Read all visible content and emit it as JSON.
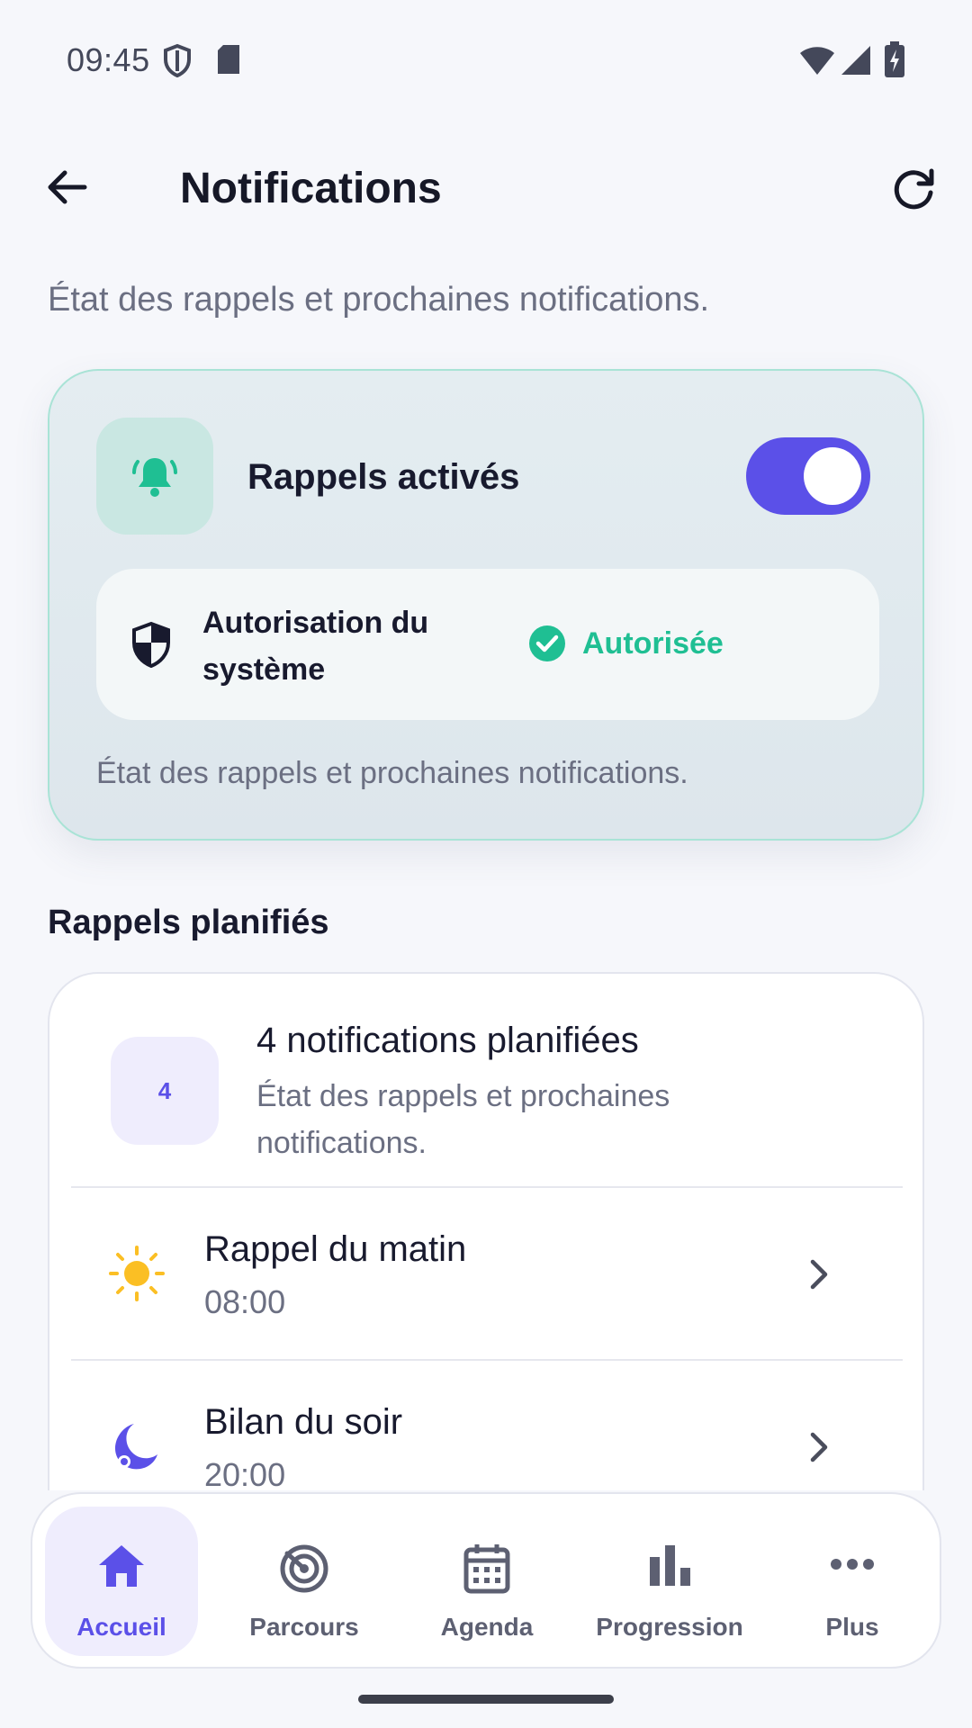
{
  "status_bar": {
    "time": "09:45"
  },
  "header": {
    "title": "Notifications"
  },
  "subtitle": "État des rappels et prochaines notifications.",
  "reminders_card": {
    "label": "Rappels activés",
    "toggle_on": true,
    "permission_label": "Autorisation du système",
    "permission_status": "Autorisée",
    "note": "État des rappels et prochaines notifications."
  },
  "scheduled": {
    "section_title": "Rappels planifiés",
    "count": "4",
    "count_title": "4 notifications planifiées",
    "count_subtitle": "État des rappels et prochaines notifications.",
    "items": [
      {
        "title": "Rappel du matin",
        "time": "08:00",
        "icon": "sun-icon"
      },
      {
        "title": "Bilan du soir",
        "time": "20:00",
        "icon": "moon-icon"
      }
    ]
  },
  "bottom_nav": [
    {
      "label": "Accueil",
      "icon": "home-icon",
      "active": true
    },
    {
      "label": "Parcours",
      "icon": "target-icon",
      "active": false
    },
    {
      "label": "Agenda",
      "icon": "calendar-icon",
      "active": false
    },
    {
      "label": "Progression",
      "icon": "bar-chart-icon",
      "active": false
    },
    {
      "label": "Plus",
      "icon": "more-icon",
      "active": false
    }
  ],
  "colors": {
    "accent": "#5b50e8",
    "success": "#1fbf93",
    "background": "#f6f7fb"
  }
}
